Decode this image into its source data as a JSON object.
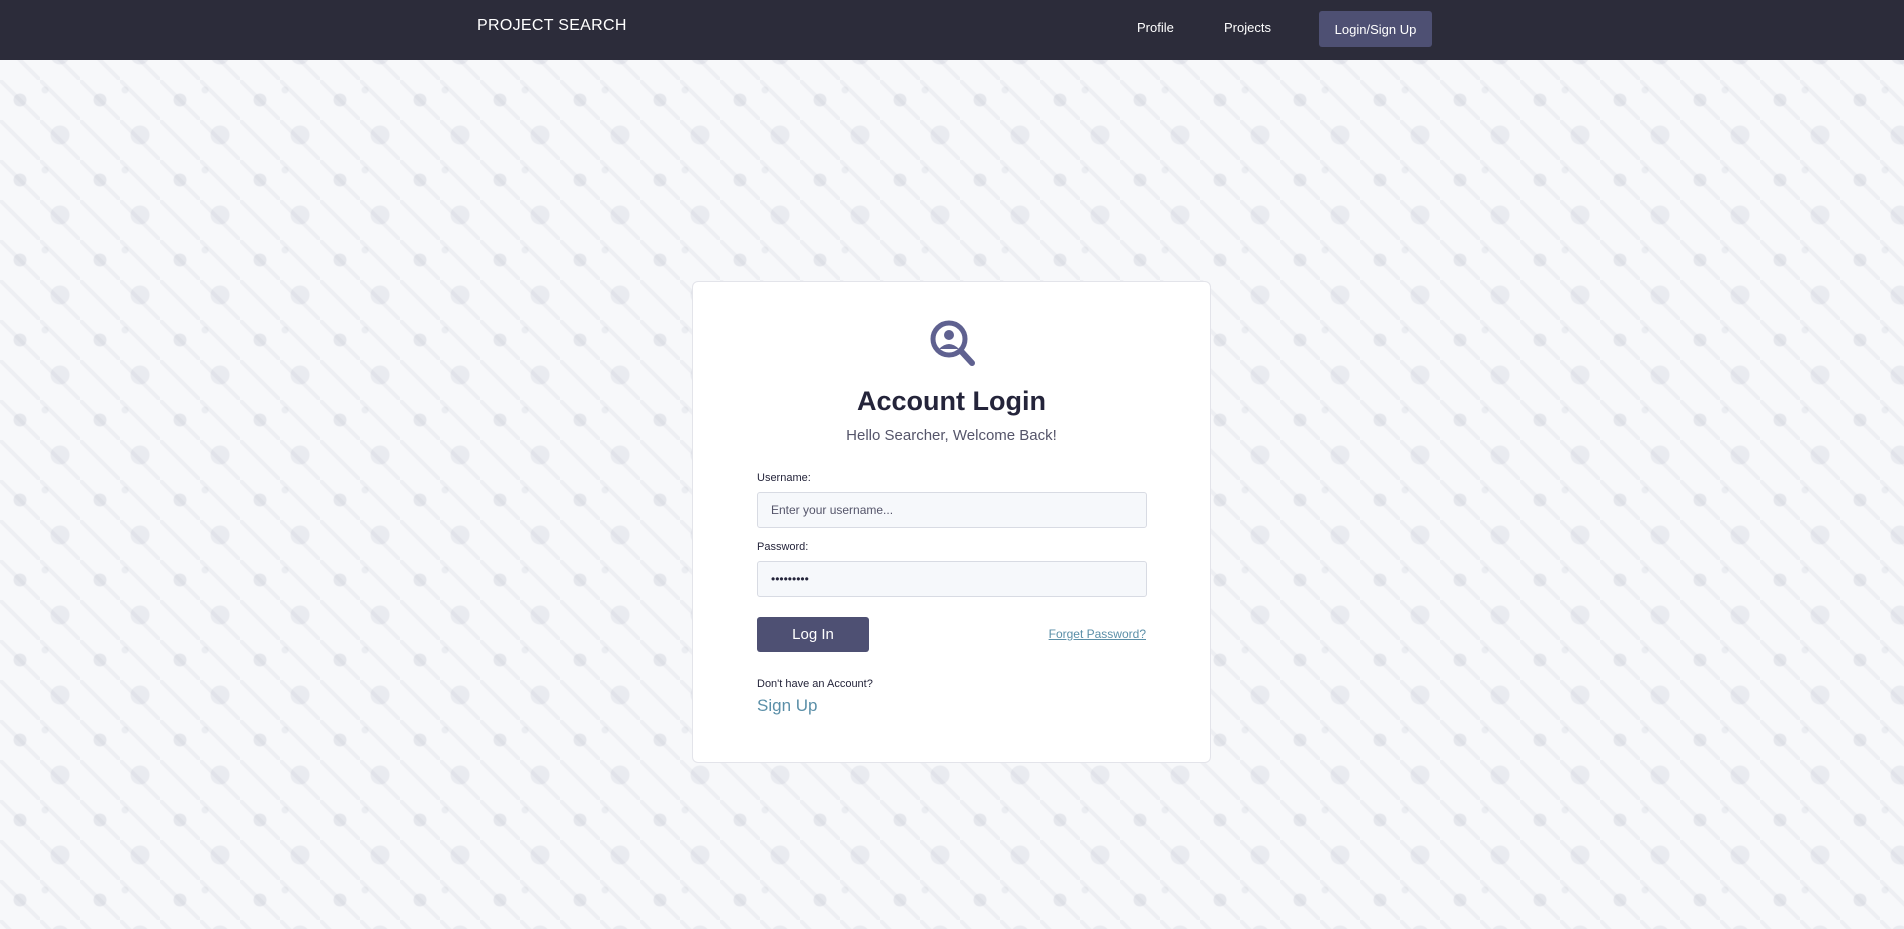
{
  "navbar": {
    "brand": "PROJECT SEARCH",
    "links": [
      {
        "label": "Profile"
      },
      {
        "label": "Projects"
      },
      {
        "label": "Login/Sign Up"
      }
    ]
  },
  "login_card": {
    "icon": "user-search-icon",
    "title": "Account Login",
    "subtitle": "Hello Searcher, Welcome Back!",
    "username": {
      "label": "Username:",
      "placeholder": "Enter your username...",
      "value": ""
    },
    "password": {
      "label": "Password:",
      "value": "•••••••••"
    },
    "login_button": "Log In",
    "forgot_link": "Forget Password?",
    "no_account_text": "Don't have an Account?",
    "signup_link": "Sign Up"
  },
  "colors": {
    "navbar_bg": "#2c2c3a",
    "accent": "#4e5073",
    "link": "#5b8fa8",
    "background": "#f7f8fa"
  }
}
